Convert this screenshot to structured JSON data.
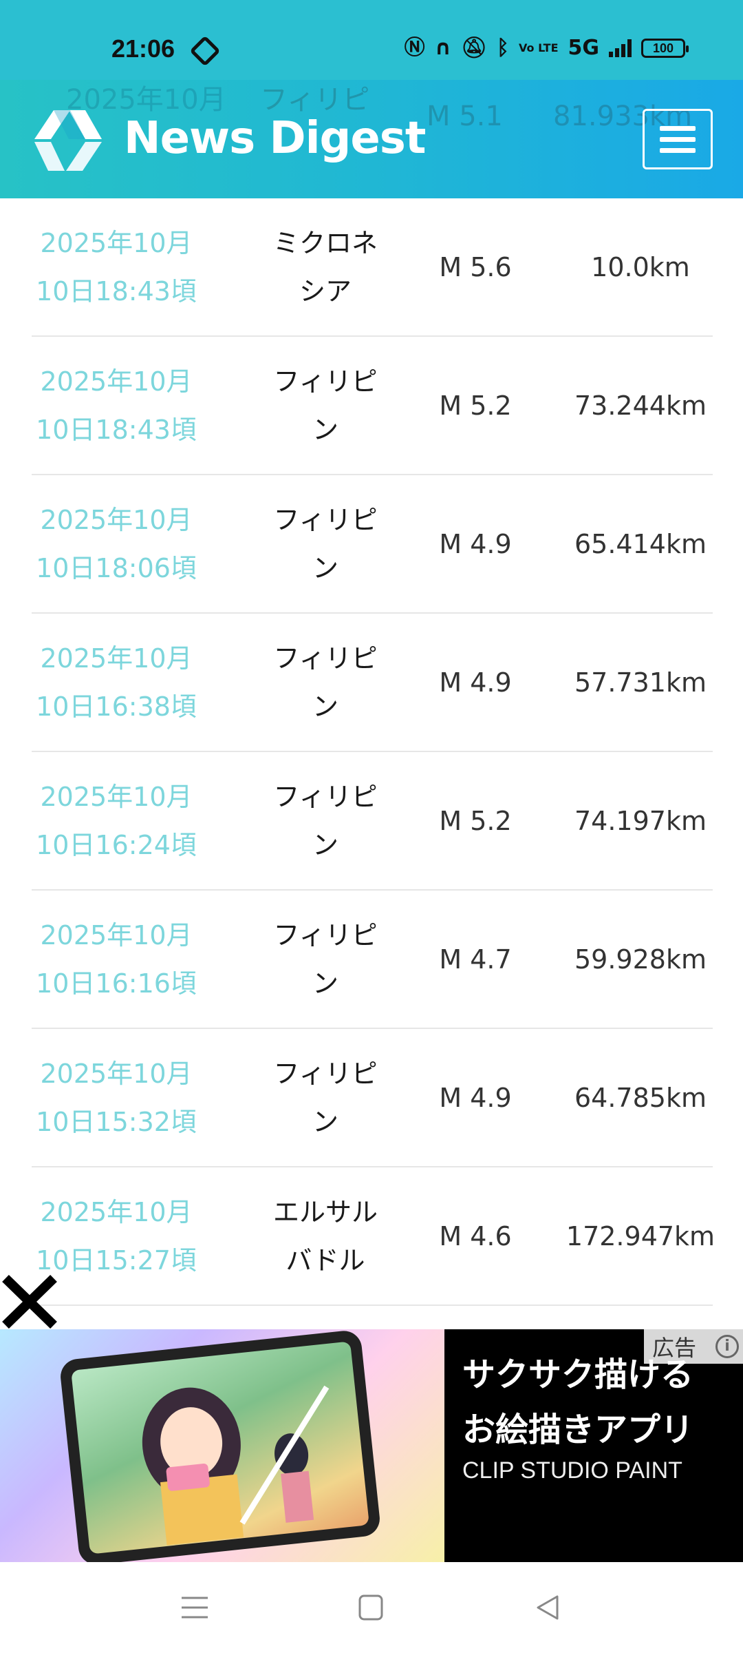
{
  "status_bar": {
    "time": "21:06",
    "network": "5G",
    "volte": "Vo LTE",
    "battery": "100",
    "icons": [
      "dnd-icon",
      "nfc-icon",
      "headphones-icon",
      "mute-icon",
      "bluetooth-icon",
      "volte-icon",
      "signal-icon",
      "battery-icon"
    ]
  },
  "header": {
    "brand": "News Digest",
    "menu_icon": "hamburger-icon",
    "accent": "#20b7d4"
  },
  "ghost_row": {
    "date": "2025年10月",
    "location": "フィリピ",
    "magnitude": "M 5.1",
    "depth": "81.933km"
  },
  "earthquakes": [
    {
      "date_line1": "2025年10月",
      "date_line2": "10日18:43頃",
      "location_line1": "ミクロネ",
      "location_line2": "シア",
      "magnitude": "M 5.6",
      "depth": "10.0km"
    },
    {
      "date_line1": "2025年10月",
      "date_line2": "10日18:43頃",
      "location_line1": "フィリピ",
      "location_line2": "ン",
      "magnitude": "M 5.2",
      "depth": "73.244km"
    },
    {
      "date_line1": "2025年10月",
      "date_line2": "10日18:06頃",
      "location_line1": "フィリピ",
      "location_line2": "ン",
      "magnitude": "M 4.9",
      "depth": "65.414km"
    },
    {
      "date_line1": "2025年10月",
      "date_line2": "10日16:38頃",
      "location_line1": "フィリピ",
      "location_line2": "ン",
      "magnitude": "M 4.9",
      "depth": "57.731km"
    },
    {
      "date_line1": "2025年10月",
      "date_line2": "10日16:24頃",
      "location_line1": "フィリピ",
      "location_line2": "ン",
      "magnitude": "M 5.2",
      "depth": "74.197km"
    },
    {
      "date_line1": "2025年10月",
      "date_line2": "10日16:16頃",
      "location_line1": "フィリピ",
      "location_line2": "ン",
      "magnitude": "M 4.7",
      "depth": "59.928km"
    },
    {
      "date_line1": "2025年10月",
      "date_line2": "10日15:32頃",
      "location_line1": "フィリピ",
      "location_line2": "ン",
      "magnitude": "M 4.9",
      "depth": "64.785km"
    },
    {
      "date_line1": "2025年10月",
      "date_line2": "10日15:27頃",
      "location_line1": "エルサル",
      "location_line2": "バドル",
      "magnitude": "M 4.6",
      "depth": "172.947km"
    }
  ],
  "ad": {
    "badge": "広告",
    "headline_line1": "サクサク描ける",
    "headline_line2": "お絵描きアプリ",
    "brand": "CLIP STUDIO PAINT"
  },
  "nav": [
    "menu-icon",
    "home-icon",
    "back-icon"
  ]
}
